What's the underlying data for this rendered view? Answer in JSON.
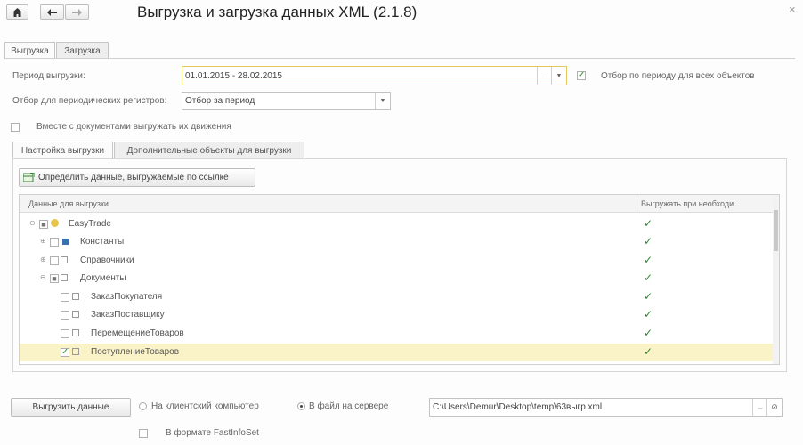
{
  "window": {
    "title": "Выгрузка и загрузка данных XML (2.1.8)",
    "home_icon": "home-icon",
    "back_icon": "arrow-left-icon",
    "forward_icon": "arrow-right-icon",
    "close_symbol": "×"
  },
  "tabs": [
    {
      "label": "Выгрузка",
      "active": true
    },
    {
      "label": "Загрузка",
      "active": false
    }
  ],
  "export": {
    "period_label": "Период выгрузки:",
    "period_value": "01.01.2015 - 28.02.2015",
    "period_button": "...",
    "filter_all_checked": true,
    "filter_all_label": "Отбор по периоду для всех объектов",
    "registers_label": "Отбор для периодических регистров:",
    "registers_value": "Отбор за период",
    "with_docs_checked": false,
    "with_docs_label": "Вместе с документами выгружать их движения"
  },
  "subtabs": [
    {
      "label": "Настройка выгрузки",
      "active": true
    },
    {
      "label": "Дополнительные объекты для выгрузки",
      "active": false
    }
  ],
  "define_button": "Определить данные, выгружаемые по ссылке",
  "table": {
    "col_data": "Данные для выгрузки",
    "col_export": "Выгружать при необходи...",
    "rows": [
      {
        "name": "EasyTrade",
        "checked": true,
        "export": true
      },
      {
        "name": "Константы",
        "checked": false,
        "export": true
      },
      {
        "name": "Справочники",
        "checked": false,
        "export": true
      },
      {
        "name": "Документы",
        "checked": true,
        "export": true
      },
      {
        "name": "ЗаказПокупателя",
        "checked": false,
        "export": true
      },
      {
        "name": "ЗаказПоставщику",
        "checked": false,
        "export": true
      },
      {
        "name": "ПеремещениеТоваров",
        "checked": false,
        "export": true
      },
      {
        "name": "ПоступлениеТоваров",
        "checked": true,
        "export": true,
        "selected": true
      }
    ]
  },
  "bottom": {
    "export_button": "Выгрузить данные",
    "radio_client": "На клиентский компьютер",
    "radio_server": "В файл на сервере",
    "server_selected": true,
    "file_path": "C:\\Users\\Demur\\Desktop\\temp\\63выгр.xml",
    "file_button": "...",
    "fastinfoset_checked": false,
    "fastinfoset_label": "В формате FastInfoSet"
  }
}
